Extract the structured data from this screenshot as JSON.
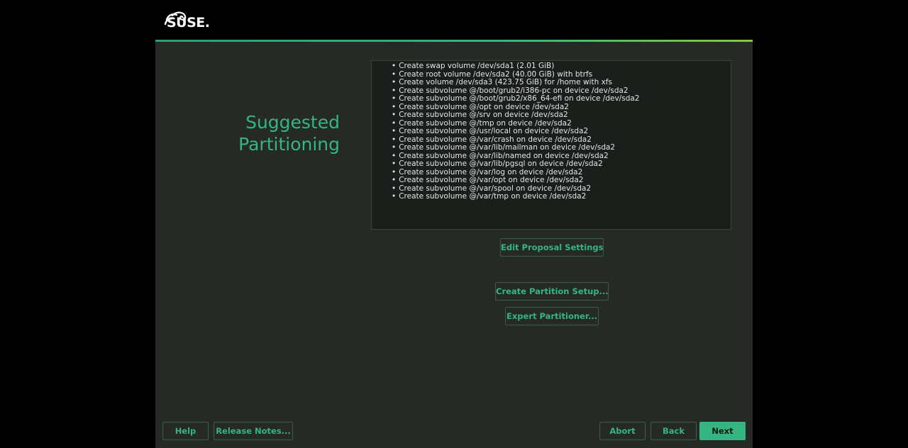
{
  "header": {
    "logo_text": "SUSE."
  },
  "page": {
    "title_line1": "Suggested",
    "title_line2": "Partitioning"
  },
  "summary": {
    "items": [
      "Create swap volume /dev/sda1 (2.01 GiB)",
      "Create root volume /dev/sda2 (40.00 GiB) with btrfs",
      "Create volume /dev/sda3 (423.75 GiB) for /home with xfs",
      "Create subvolume @/boot/grub2/i386-pc on device /dev/sda2",
      "Create subvolume @/boot/grub2/x86_64-efi on device /dev/sda2",
      "Create subvolume @/opt on device /dev/sda2",
      "Create subvolume @/srv on device /dev/sda2",
      "Create subvolume @/tmp on device /dev/sda2",
      "Create subvolume @/usr/local on device /dev/sda2",
      "Create subvolume @/var/crash on device /dev/sda2",
      "Create subvolume @/var/lib/mailman on device /dev/sda2",
      "Create subvolume @/var/lib/named on device /dev/sda2",
      "Create subvolume @/var/lib/pgsql on device /dev/sda2",
      "Create subvolume @/var/log on device /dev/sda2",
      "Create subvolume @/var/opt on device /dev/sda2",
      "Create subvolume @/var/spool on device /dev/sda2",
      "Create subvolume @/var/tmp on device /dev/sda2"
    ]
  },
  "actions": {
    "edit_proposal": "Edit Proposal Settings",
    "create_partition_setup": "Create Partition Setup...",
    "expert_partitioner": "Expert Partitioner..."
  },
  "footer": {
    "help": "Help",
    "release_notes": "Release Notes...",
    "abort": "Abort",
    "back": "Back",
    "next": "Next"
  },
  "colors": {
    "accent": "#35b581",
    "background": "#252a27",
    "text": "#e6e6e6"
  },
  "icons": {
    "logo": "suse-chameleon-logo-icon"
  }
}
